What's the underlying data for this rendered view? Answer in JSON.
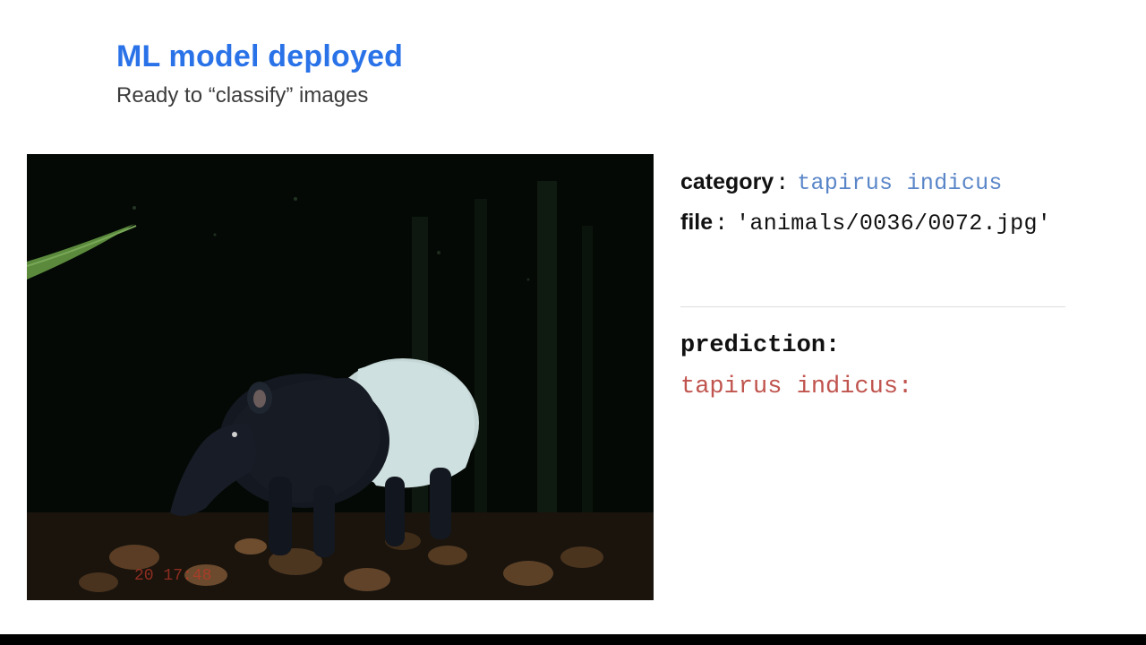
{
  "header": {
    "title": "ML model deployed",
    "subtitle": "Ready to “classify” images"
  },
  "metadata": {
    "category_label": "category",
    "category_value": "tapirus indicus",
    "file_label": "file",
    "file_value": "'animals/0036/0072.jpg'"
  },
  "prediction": {
    "label": "prediction:",
    "value": "tapirus indicus:"
  },
  "image": {
    "description": "night-time trail-camera photo of a Malayan tapir (tapirus indicus) on leaf-littered forest floor, dark background with tree trunks, green leaf visible top-left",
    "timestamp_overlay": "20  17:48"
  },
  "colors": {
    "accent_blue": "#2a72e8",
    "label_blue": "#5a86c8",
    "prediction_red": "#c0544e"
  }
}
